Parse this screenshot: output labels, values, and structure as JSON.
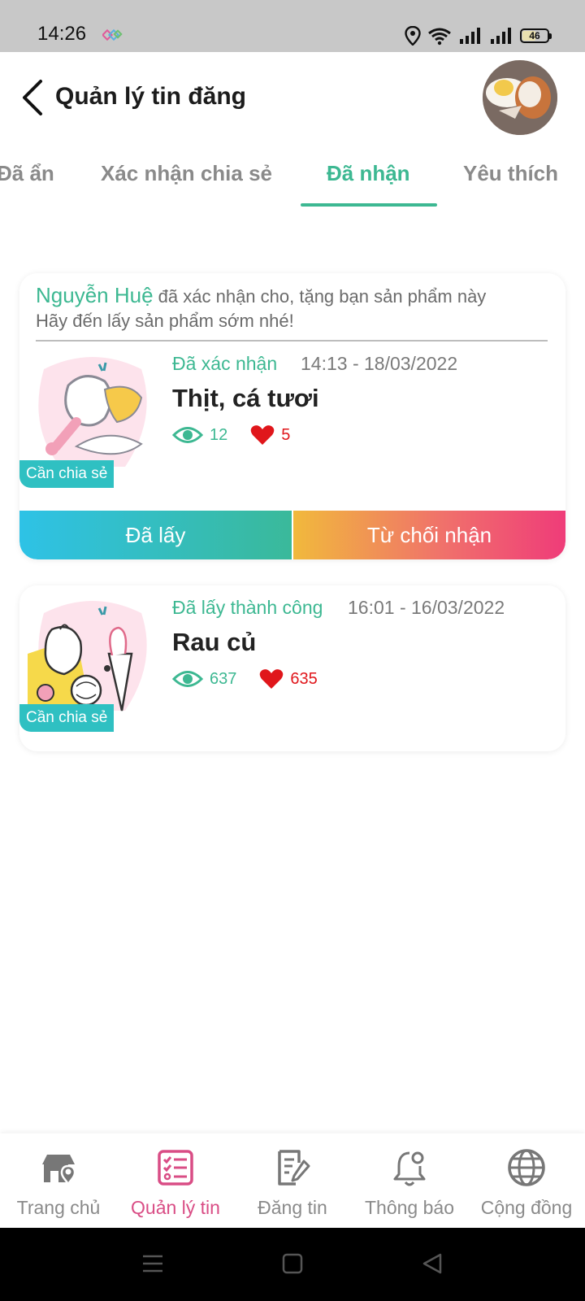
{
  "status_bar": {
    "time": "14:26",
    "battery": "46"
  },
  "header": {
    "title": "Quản lý tin đăng"
  },
  "tabs": [
    {
      "label": "Đã ẩn"
    },
    {
      "label": "Xác nhận chia sẻ"
    },
    {
      "label": "Đã nhận",
      "active": true
    },
    {
      "label": "Yêu thích"
    }
  ],
  "cards": [
    {
      "notice_name": "Nguyễn Huệ",
      "notice_text": "đã xác nhận cho, tặng bạn sản phẩm này",
      "notice_line2": "Hãy đến lấy sản phẩm sớm nhé!",
      "status": "Đã xác nhận",
      "time": "14:13 - 18/03/2022",
      "title": "Thịt, cá tươi",
      "views": "12",
      "likes": "5",
      "tag": "Cần chia sẻ",
      "btn_taken": "Đã lấy",
      "btn_reject": "Từ chối nhận"
    },
    {
      "status": "Đã lấy thành công",
      "time": "16:01 - 16/03/2022",
      "title": "Rau củ",
      "views": "637",
      "likes": "635",
      "tag": "Cần chia sẻ"
    }
  ],
  "bottom_nav": [
    {
      "label": "Trang chủ",
      "icon": "home-location-icon"
    },
    {
      "label": "Quản lý tin",
      "icon": "checklist-icon",
      "active": true
    },
    {
      "label": "Đăng tin",
      "icon": "edit-document-icon"
    },
    {
      "label": "Thông báo",
      "icon": "bell-icon"
    },
    {
      "label": "Cộng đồng",
      "icon": "globe-icon"
    }
  ],
  "colors": {
    "accent": "#3db892",
    "active_nav": "#d94d85",
    "like": "#e0161b",
    "tag": "#2fc0c2"
  }
}
